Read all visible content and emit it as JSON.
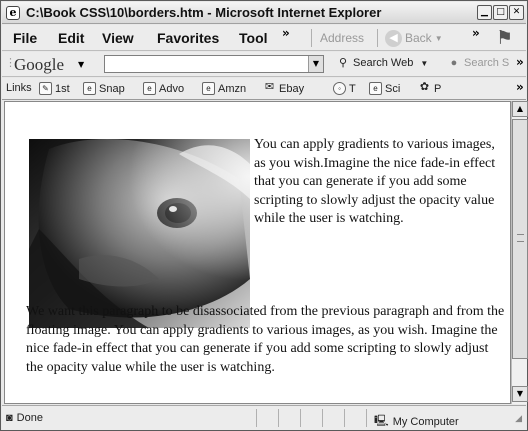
{
  "window": {
    "title": "C:\\Book CSS\\10\\borders.htm - Microsoft Internet Explorer",
    "app_icon": "e"
  },
  "menubar": {
    "items": [
      "File",
      "Edit",
      "View",
      "Favorites",
      "Tool"
    ],
    "overflow": "»",
    "address_label": "Address",
    "back_label": "Back",
    "back_arrow": "◀"
  },
  "googlebar": {
    "logo": "Google",
    "search_value": "",
    "search_web": "Search Web",
    "search_site": "Search S"
  },
  "linksbar": {
    "label": "Links",
    "items": [
      "1st",
      "Snap",
      "Advo",
      "Amzn",
      "Ebay",
      "T",
      "Sci",
      "P"
    ]
  },
  "content": {
    "paragraph1": "You can apply gradients to various images, as you wish.Imagine the nice fade-in effect that you can generate if you add some scripting to slowly adjust the opacity value while the user is watching.",
    "paragraph2": "We want this paragraph to be disassociated from the previous paragraph and from the floating image. You can apply gradients to various images, as you wish. Imagine the nice fade-in effect that you can generate if you add some scripting to slowly adjust the opacity value while the user is watching."
  },
  "statusbar": {
    "status": "Done",
    "zone": "My Computer"
  }
}
